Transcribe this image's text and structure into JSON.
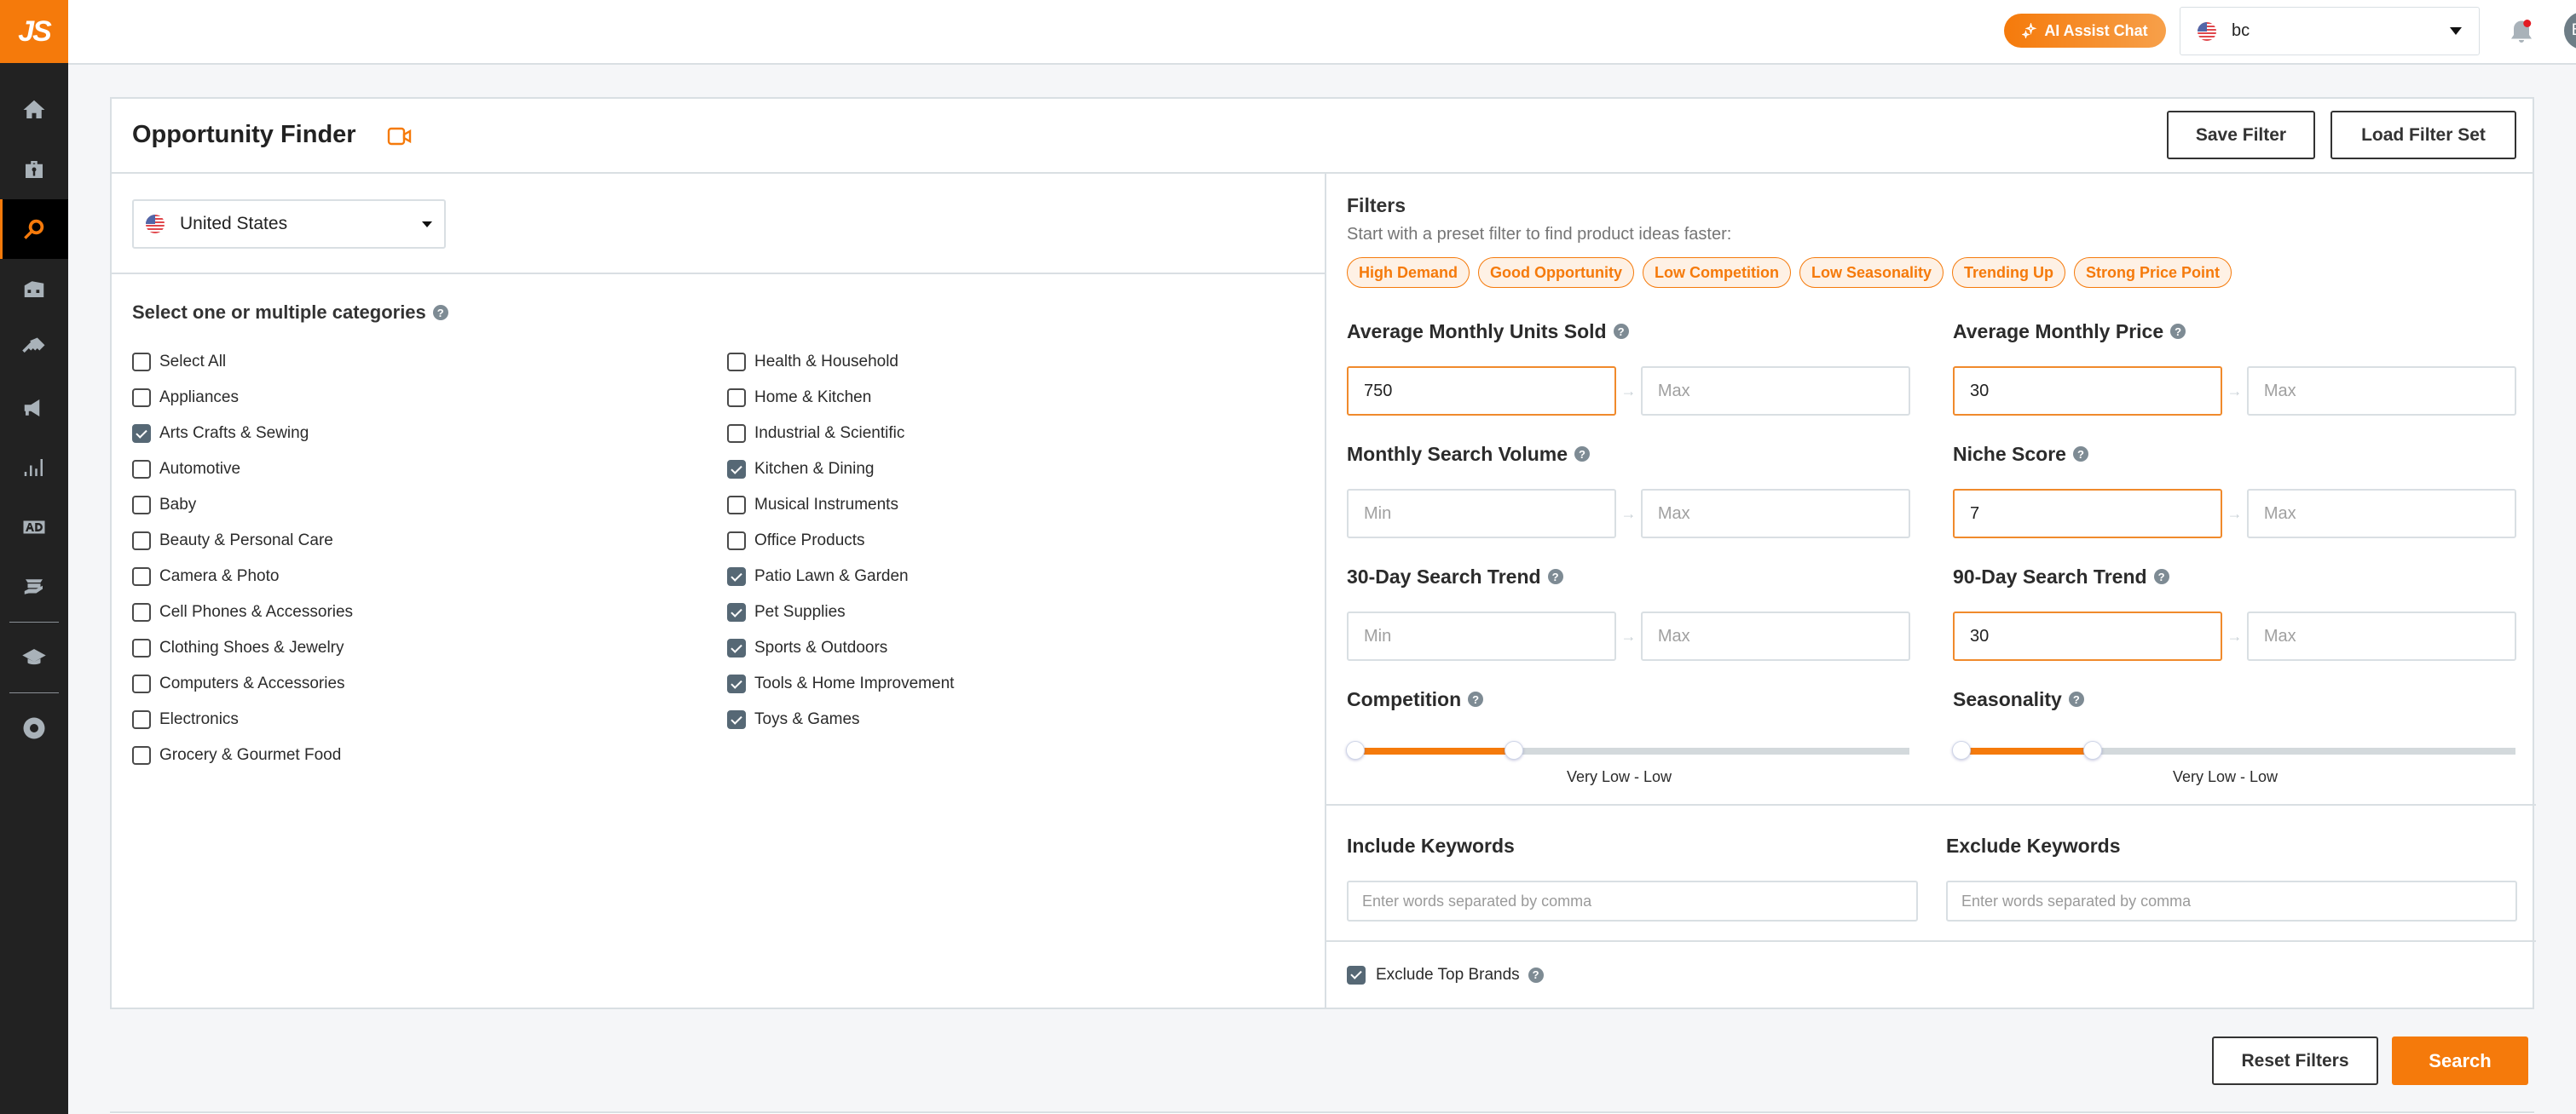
{
  "app": {
    "logo_text": "JS",
    "accent_color": "#f57a0b"
  },
  "sidebar": {
    "items": [
      {
        "name": "home",
        "icon": "home-icon",
        "active": false
      },
      {
        "name": "toolbox",
        "icon": "toolbox-icon",
        "active": false
      },
      {
        "name": "opportunity-finder",
        "icon": "search-icon",
        "active": true
      },
      {
        "name": "warehouse",
        "icon": "warehouse-icon",
        "active": false
      },
      {
        "name": "keywords",
        "icon": "key-icon",
        "active": false
      },
      {
        "name": "marketing",
        "icon": "megaphone-icon",
        "active": false
      },
      {
        "name": "analytics",
        "icon": "bar-chart-icon",
        "active": false
      },
      {
        "name": "advertising",
        "icon": "ad-icon",
        "active": false
      },
      {
        "name": "supplier",
        "icon": "product-hand-icon",
        "active": false
      },
      {
        "name": "academy",
        "icon": "graduation-cap-icon",
        "active": false
      },
      {
        "name": "extension",
        "icon": "chrome-extension-icon",
        "active": false
      }
    ]
  },
  "header": {
    "ai_button_label": "AI Assist Chat",
    "account_name": "bc",
    "account_flag": "us-flag",
    "notification_badge": true,
    "avatar_initials": "BC"
  },
  "page": {
    "title": "Opportunity Finder",
    "save_filter_label": "Save Filter",
    "load_filter_label": "Load Filter Set",
    "country": "United States",
    "categories_title": "Select one or multiple categories",
    "categories_col1": [
      {
        "label": "Select All",
        "checked": false
      },
      {
        "label": "Appliances",
        "checked": false
      },
      {
        "label": "Arts Crafts & Sewing",
        "checked": true
      },
      {
        "label": "Automotive",
        "checked": false
      },
      {
        "label": "Baby",
        "checked": false
      },
      {
        "label": "Beauty & Personal Care",
        "checked": false
      },
      {
        "label": "Camera & Photo",
        "checked": false
      },
      {
        "label": "Cell Phones & Accessories",
        "checked": false
      },
      {
        "label": "Clothing Shoes & Jewelry",
        "checked": false
      },
      {
        "label": "Computers & Accessories",
        "checked": false
      },
      {
        "label": "Electronics",
        "checked": false
      },
      {
        "label": "Grocery & Gourmet Food",
        "checked": false
      }
    ],
    "categories_col2": [
      {
        "label": "Health & Household",
        "checked": false
      },
      {
        "label": "Home & Kitchen",
        "checked": false
      },
      {
        "label": "Industrial & Scientific",
        "checked": false
      },
      {
        "label": "Kitchen & Dining",
        "checked": true
      },
      {
        "label": "Musical Instruments",
        "checked": false
      },
      {
        "label": "Office Products",
        "checked": false
      },
      {
        "label": "Patio Lawn & Garden",
        "checked": true
      },
      {
        "label": "Pet Supplies",
        "checked": true
      },
      {
        "label": "Sports & Outdoors",
        "checked": true
      },
      {
        "label": "Tools & Home Improvement",
        "checked": true
      },
      {
        "label": "Toys & Games",
        "checked": true
      }
    ]
  },
  "filters": {
    "title": "Filters",
    "subtitle": "Start with a preset filter to find product ideas faster:",
    "presets": [
      "High Demand",
      "Good Opportunity",
      "Low Competition",
      "Low Seasonality",
      "Trending Up",
      "Strong Price Point"
    ],
    "min_placeholder": "Min",
    "max_placeholder": "Max",
    "ranges": {
      "units_sold": {
        "label": "Average Monthly Units Sold",
        "min": "750",
        "max": ""
      },
      "price": {
        "label": "Average Monthly Price",
        "min": "30",
        "max": ""
      },
      "search_volume": {
        "label": "Monthly Search Volume",
        "min": "",
        "max": ""
      },
      "niche_score": {
        "label": "Niche Score",
        "min": "7",
        "max": ""
      },
      "trend_30": {
        "label": "30-Day Search Trend",
        "min": "",
        "max": ""
      },
      "trend_90": {
        "label": "90-Day Search Trend",
        "min": "30",
        "max": ""
      }
    },
    "competition": {
      "label": "Competition",
      "value_text": "Very Low  -  Low",
      "range_fraction": [
        0,
        0.29
      ]
    },
    "seasonality": {
      "label": "Seasonality",
      "value_text": "Very Low  -  Low",
      "range_fraction": [
        0,
        0.24
      ]
    },
    "include_keywords": {
      "label": "Include Keywords",
      "placeholder": "Enter words separated by comma",
      "value": ""
    },
    "exclude_keywords": {
      "label": "Exclude Keywords",
      "placeholder": "Enter words separated by comma",
      "value": ""
    },
    "exclude_top_brands": {
      "label": "Exclude Top Brands",
      "checked": true
    }
  },
  "actions": {
    "reset_label": "Reset Filters",
    "search_label": "Search"
  }
}
